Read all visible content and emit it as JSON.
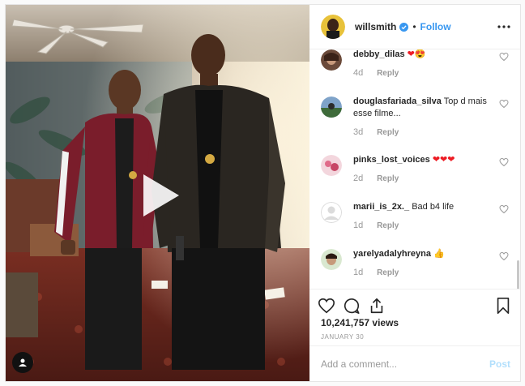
{
  "header": {
    "username": "willsmith",
    "separator": "•",
    "follow_label": "Follow",
    "more_icon": "more-horizontal-icon",
    "verified_icon": "verified-badge-icon"
  },
  "media": {
    "type": "video",
    "play_icon": "play-icon",
    "user_tag_icon": "user-tag-icon"
  },
  "comments": [
    {
      "user": "debby_dilas",
      "text": "❤😍",
      "time": "4d",
      "reply": "Reply"
    },
    {
      "user": "douglasfariada_silva",
      "text": "Top d mais esse filme...",
      "time": "3d",
      "reply": "Reply"
    },
    {
      "user": "pinks_lost_voices",
      "text": "❤❤❤",
      "time": "2d",
      "reply": "Reply"
    },
    {
      "user": "marii_is_2x._",
      "text": "Bad b4 life",
      "time": "1d",
      "reply": "Reply"
    },
    {
      "user": "yarelyadalyhreyna",
      "text": "👍",
      "time": "1d",
      "reply": "Reply"
    }
  ],
  "actions": {
    "like_icon": "heart-icon",
    "comment_icon": "comment-icon",
    "share_icon": "share-icon",
    "save_icon": "bookmark-icon"
  },
  "stats": {
    "views": "10,241,757 views",
    "date": "JANUARY 30"
  },
  "add_comment": {
    "placeholder": "Add a comment...",
    "post_label": "Post"
  },
  "colors": {
    "link_blue": "#3897f0",
    "post_disabled": "#b2dffc",
    "verified": "#3897f0",
    "heart_red": "#ed1c24"
  }
}
